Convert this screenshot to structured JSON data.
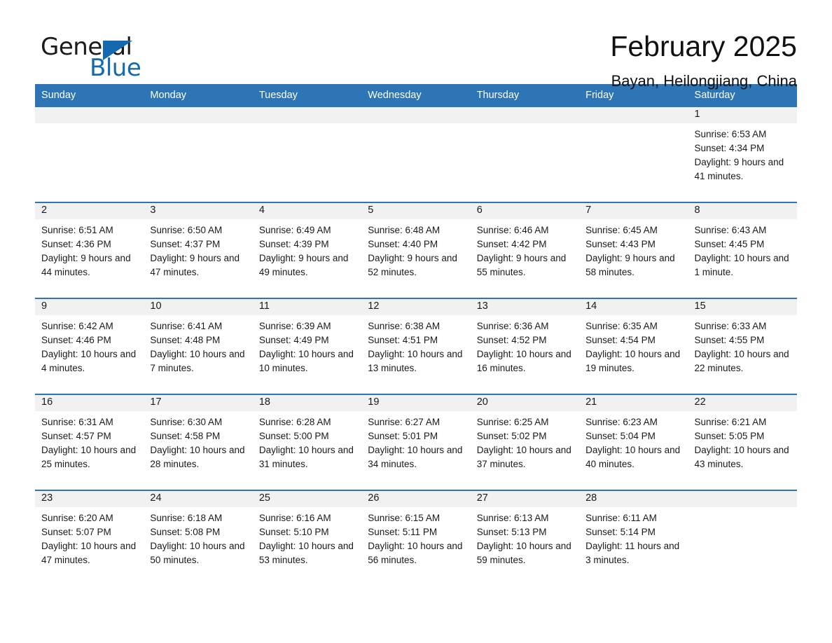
{
  "logo": {
    "text_top": "General",
    "text_bottom": "Blue",
    "triangle_color": "#1569b0",
    "icon": "blue-triangle-logo-mark"
  },
  "header": {
    "title": "February 2025",
    "subtitle": "Bayan, Heilongjiang, China"
  },
  "colors": {
    "header_blue": "#2e75b6",
    "row_divider_blue": "#2e75b6",
    "daynum_band": "#f1f1f1",
    "text": "#1a1a1a",
    "logo_blue": "#1569b0"
  },
  "weekday_headers": [
    "Sunday",
    "Monday",
    "Tuesday",
    "Wednesday",
    "Thursday",
    "Friday",
    "Saturday"
  ],
  "weeks": [
    [
      {
        "day": "",
        "sunrise": "",
        "sunset": "",
        "daylight": ""
      },
      {
        "day": "",
        "sunrise": "",
        "sunset": "",
        "daylight": ""
      },
      {
        "day": "",
        "sunrise": "",
        "sunset": "",
        "daylight": ""
      },
      {
        "day": "",
        "sunrise": "",
        "sunset": "",
        "daylight": ""
      },
      {
        "day": "",
        "sunrise": "",
        "sunset": "",
        "daylight": ""
      },
      {
        "day": "",
        "sunrise": "",
        "sunset": "",
        "daylight": ""
      },
      {
        "day": "1",
        "sunrise": "Sunrise: 6:53 AM",
        "sunset": "Sunset: 4:34 PM",
        "daylight": "Daylight: 9 hours and 41 minutes."
      }
    ],
    [
      {
        "day": "2",
        "sunrise": "Sunrise: 6:51 AM",
        "sunset": "Sunset: 4:36 PM",
        "daylight": "Daylight: 9 hours and 44 minutes."
      },
      {
        "day": "3",
        "sunrise": "Sunrise: 6:50 AM",
        "sunset": "Sunset: 4:37 PM",
        "daylight": "Daylight: 9 hours and 47 minutes."
      },
      {
        "day": "4",
        "sunrise": "Sunrise: 6:49 AM",
        "sunset": "Sunset: 4:39 PM",
        "daylight": "Daylight: 9 hours and 49 minutes."
      },
      {
        "day": "5",
        "sunrise": "Sunrise: 6:48 AM",
        "sunset": "Sunset: 4:40 PM",
        "daylight": "Daylight: 9 hours and 52 minutes."
      },
      {
        "day": "6",
        "sunrise": "Sunrise: 6:46 AM",
        "sunset": "Sunset: 4:42 PM",
        "daylight": "Daylight: 9 hours and 55 minutes."
      },
      {
        "day": "7",
        "sunrise": "Sunrise: 6:45 AM",
        "sunset": "Sunset: 4:43 PM",
        "daylight": "Daylight: 9 hours and 58 minutes."
      },
      {
        "day": "8",
        "sunrise": "Sunrise: 6:43 AM",
        "sunset": "Sunset: 4:45 PM",
        "daylight": "Daylight: 10 hours and 1 minute."
      }
    ],
    [
      {
        "day": "9",
        "sunrise": "Sunrise: 6:42 AM",
        "sunset": "Sunset: 4:46 PM",
        "daylight": "Daylight: 10 hours and 4 minutes."
      },
      {
        "day": "10",
        "sunrise": "Sunrise: 6:41 AM",
        "sunset": "Sunset: 4:48 PM",
        "daylight": "Daylight: 10 hours and 7 minutes."
      },
      {
        "day": "11",
        "sunrise": "Sunrise: 6:39 AM",
        "sunset": "Sunset: 4:49 PM",
        "daylight": "Daylight: 10 hours and 10 minutes."
      },
      {
        "day": "12",
        "sunrise": "Sunrise: 6:38 AM",
        "sunset": "Sunset: 4:51 PM",
        "daylight": "Daylight: 10 hours and 13 minutes."
      },
      {
        "day": "13",
        "sunrise": "Sunrise: 6:36 AM",
        "sunset": "Sunset: 4:52 PM",
        "daylight": "Daylight: 10 hours and 16 minutes."
      },
      {
        "day": "14",
        "sunrise": "Sunrise: 6:35 AM",
        "sunset": "Sunset: 4:54 PM",
        "daylight": "Daylight: 10 hours and 19 minutes."
      },
      {
        "day": "15",
        "sunrise": "Sunrise: 6:33 AM",
        "sunset": "Sunset: 4:55 PM",
        "daylight": "Daylight: 10 hours and 22 minutes."
      }
    ],
    [
      {
        "day": "16",
        "sunrise": "Sunrise: 6:31 AM",
        "sunset": "Sunset: 4:57 PM",
        "daylight": "Daylight: 10 hours and 25 minutes."
      },
      {
        "day": "17",
        "sunrise": "Sunrise: 6:30 AM",
        "sunset": "Sunset: 4:58 PM",
        "daylight": "Daylight: 10 hours and 28 minutes."
      },
      {
        "day": "18",
        "sunrise": "Sunrise: 6:28 AM",
        "sunset": "Sunset: 5:00 PM",
        "daylight": "Daylight: 10 hours and 31 minutes."
      },
      {
        "day": "19",
        "sunrise": "Sunrise: 6:27 AM",
        "sunset": "Sunset: 5:01 PM",
        "daylight": "Daylight: 10 hours and 34 minutes."
      },
      {
        "day": "20",
        "sunrise": "Sunrise: 6:25 AM",
        "sunset": "Sunset: 5:02 PM",
        "daylight": "Daylight: 10 hours and 37 minutes."
      },
      {
        "day": "21",
        "sunrise": "Sunrise: 6:23 AM",
        "sunset": "Sunset: 5:04 PM",
        "daylight": "Daylight: 10 hours and 40 minutes."
      },
      {
        "day": "22",
        "sunrise": "Sunrise: 6:21 AM",
        "sunset": "Sunset: 5:05 PM",
        "daylight": "Daylight: 10 hours and 43 minutes."
      }
    ],
    [
      {
        "day": "23",
        "sunrise": "Sunrise: 6:20 AM",
        "sunset": "Sunset: 5:07 PM",
        "daylight": "Daylight: 10 hours and 47 minutes."
      },
      {
        "day": "24",
        "sunrise": "Sunrise: 6:18 AM",
        "sunset": "Sunset: 5:08 PM",
        "daylight": "Daylight: 10 hours and 50 minutes."
      },
      {
        "day": "25",
        "sunrise": "Sunrise: 6:16 AM",
        "sunset": "Sunset: 5:10 PM",
        "daylight": "Daylight: 10 hours and 53 minutes."
      },
      {
        "day": "26",
        "sunrise": "Sunrise: 6:15 AM",
        "sunset": "Sunset: 5:11 PM",
        "daylight": "Daylight: 10 hours and 56 minutes."
      },
      {
        "day": "27",
        "sunrise": "Sunrise: 6:13 AM",
        "sunset": "Sunset: 5:13 PM",
        "daylight": "Daylight: 10 hours and 59 minutes."
      },
      {
        "day": "28",
        "sunrise": "Sunrise: 6:11 AM",
        "sunset": "Sunset: 5:14 PM",
        "daylight": "Daylight: 11 hours and 3 minutes."
      },
      {
        "day": "",
        "sunrise": "",
        "sunset": "",
        "daylight": ""
      }
    ]
  ]
}
